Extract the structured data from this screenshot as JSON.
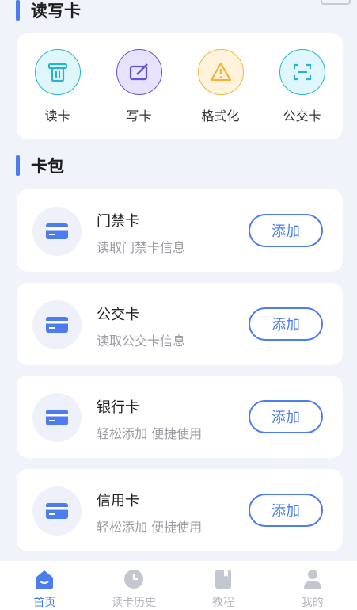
{
  "read_write": {
    "title": "读写卡",
    "items": [
      {
        "label": "读卡",
        "icon": "read-card-icon",
        "color": "#26b5c8",
        "bg": "#dff7fa"
      },
      {
        "label": "写卡",
        "icon": "write-card-icon",
        "color": "#6254d8",
        "bg": "#e7e3ff"
      },
      {
        "label": "格式化",
        "icon": "format-warning-icon",
        "color": "#f2b33a",
        "bg": "#fff3dc"
      },
      {
        "label": "公交卡",
        "icon": "scan-icon",
        "color": "#26b5c8",
        "bg": "#dff7fa"
      }
    ]
  },
  "wallet": {
    "title": "卡包",
    "cards": [
      {
        "title": "门禁卡",
        "desc": "读取门禁卡信息",
        "button": "添加"
      },
      {
        "title": "公交卡",
        "desc": "读取公交卡信息",
        "button": "添加"
      },
      {
        "title": "银行卡",
        "desc": "轻松添加 便捷使用",
        "button": "添加"
      },
      {
        "title": "信用卡",
        "desc": "轻松添加 便捷使用",
        "button": "添加"
      }
    ]
  },
  "tabbar": {
    "items": [
      {
        "label": "首页",
        "icon": "home-icon",
        "active": true
      },
      {
        "label": "读卡历史",
        "icon": "history-clock-icon",
        "active": false
      },
      {
        "label": "教程",
        "icon": "tutorial-book-icon",
        "active": false
      },
      {
        "label": "我的",
        "icon": "profile-icon",
        "active": false
      }
    ]
  },
  "colors": {
    "accent": "#4d7cf0",
    "background": "#f1f3fa",
    "muted": "#b3b6be"
  }
}
